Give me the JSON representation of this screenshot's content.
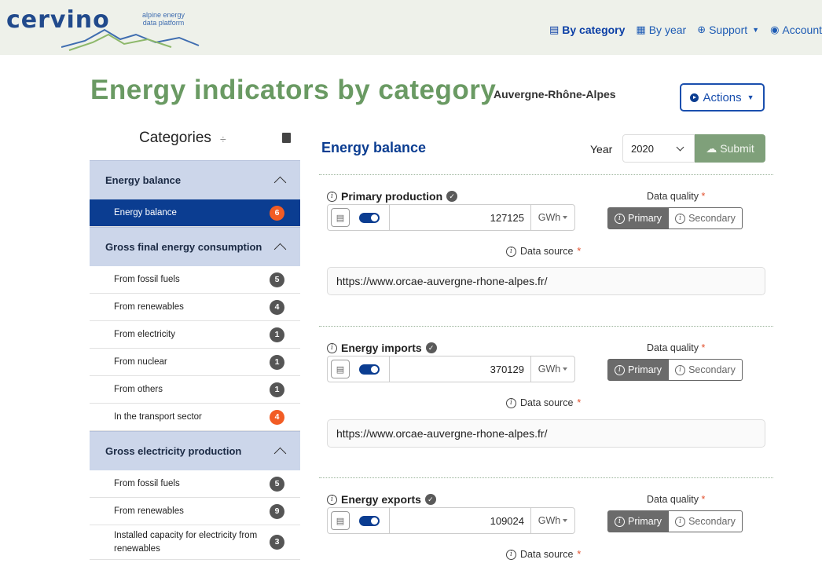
{
  "header": {
    "logo_text": "cervino",
    "logo_tagline_1": "alpine energy",
    "logo_tagline_2": "data platform",
    "nav": [
      {
        "label": "By category",
        "icon": "list-icon"
      },
      {
        "label": "By year",
        "icon": "calendar-icon"
      },
      {
        "label": "Support",
        "icon": "lifebuoy-icon"
      },
      {
        "label": "Account",
        "icon": "user-circle-icon"
      }
    ]
  },
  "page": {
    "title": "Energy indicators by category",
    "region": "Auvergne-Rhône-Alpes",
    "actions_label": "Actions"
  },
  "sidebar": {
    "title": "Categories",
    "groups": [
      {
        "label": "Energy balance",
        "items": [
          {
            "label": "Energy balance",
            "count": "6"
          }
        ]
      },
      {
        "label": "Gross final energy consumption",
        "items": [
          {
            "label": "From fossil fuels",
            "count": "5"
          },
          {
            "label": "From renewables",
            "count": "4"
          },
          {
            "label": "From electricity",
            "count": "1"
          },
          {
            "label": "From nuclear",
            "count": "1"
          },
          {
            "label": "From others",
            "count": "1"
          },
          {
            "label": "In the transport sector",
            "count": "4"
          }
        ]
      },
      {
        "label": "Gross electricity production",
        "items": [
          {
            "label": "From fossil fuels",
            "count": "5"
          },
          {
            "label": "From renewables",
            "count": "9"
          },
          {
            "label": "Installed capacity for electricity from renewables",
            "count": "3"
          }
        ]
      }
    ]
  },
  "main": {
    "section_title": "Energy balance",
    "year_label": "Year",
    "year_value": "2020",
    "submit_label": "Submit",
    "data_quality_label": "Data quality",
    "required_mark": "*",
    "data_source_label": "Data source",
    "primary_label": "Primary",
    "secondary_label": "Secondary",
    "indicators": [
      {
        "title": "Primary production",
        "value": "127125",
        "unit": "GWh",
        "source": "https://www.orcae-auvergne-rhone-alpes.fr/"
      },
      {
        "title": "Energy imports",
        "value": "370129",
        "unit": "GWh",
        "source": "https://www.orcae-auvergne-rhone-alpes.fr/"
      },
      {
        "title": "Energy exports",
        "value": "109024",
        "unit": "GWh",
        "source": ""
      }
    ]
  },
  "colors": {
    "brand_green": "#6a9a63",
    "brand_blue": "#0b3d91",
    "badge_orange": "#f25c24"
  }
}
